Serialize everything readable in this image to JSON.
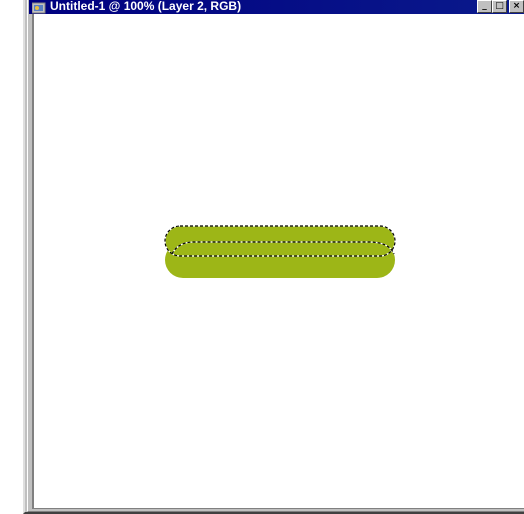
{
  "window": {
    "title": "Untitled-1 @ 100% (Layer 2, RGB)",
    "controls": {
      "minimize_glyph": "_",
      "maximize_glyph": "□",
      "close_glyph": "×"
    },
    "icon": "photoshop-document-icon"
  },
  "colors": {
    "title_bar": "#000080",
    "shape_fill": "#9db617",
    "canvas": "#ffffff",
    "frame": "#c0c0c0"
  },
  "canvas": {
    "shape": "rounded-pill-with-selection-marquee"
  }
}
